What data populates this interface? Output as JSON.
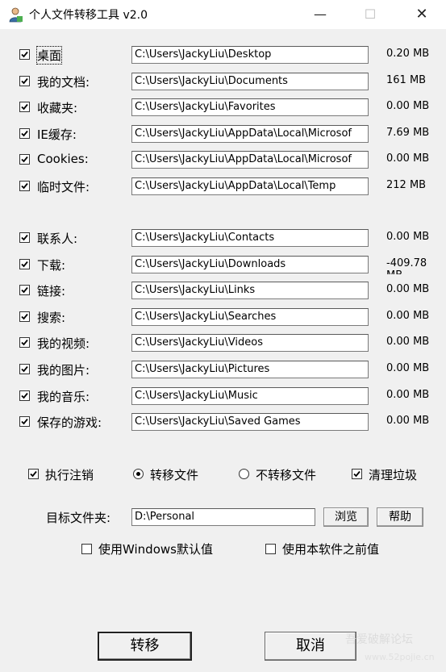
{
  "window": {
    "title": "个人文件转移工具 v2.0",
    "min": "—",
    "max": "☐",
    "close": "✕"
  },
  "folders_group1": [
    {
      "label": "桌面",
      "path": "C:\\Users\\JackyLiu\\Desktop",
      "size": "0.20 MB",
      "checked": true
    },
    {
      "label": "我的文档:",
      "path": "C:\\Users\\JackyLiu\\Documents",
      "size": "161  MB",
      "checked": true
    },
    {
      "label": "收藏夹:",
      "path": "C:\\Users\\JackyLiu\\Favorites",
      "size": "0.00 MB",
      "checked": true
    },
    {
      "label": "IE缓存:",
      "path": "C:\\Users\\JackyLiu\\AppData\\Local\\Microsof",
      "size": "7.69 MB",
      "checked": true
    },
    {
      "label": "Cookies:",
      "path": "C:\\Users\\JackyLiu\\AppData\\Local\\Microsof",
      "size": "0.00 MB",
      "checked": true
    },
    {
      "label": "临时文件:",
      "path": "C:\\Users\\JackyLiu\\AppData\\Local\\Temp",
      "size": "212  MB",
      "checked": true
    }
  ],
  "folders_group2": [
    {
      "label": "联系人:",
      "path": "C:\\Users\\JackyLiu\\Contacts",
      "size": "0.00 MB",
      "checked": true
    },
    {
      "label": "下载:",
      "path": "C:\\Users\\JackyLiu\\Downloads",
      "size": "-409.78",
      "size_extra": "MB",
      "checked": true
    },
    {
      "label": "链接:",
      "path": "C:\\Users\\JackyLiu\\Links",
      "size": "0.00 MB",
      "checked": true
    },
    {
      "label": "搜索:",
      "path": "C:\\Users\\JackyLiu\\Searches",
      "size": "0.00 MB",
      "checked": true
    },
    {
      "label": "我的视频:",
      "path": "C:\\Users\\JackyLiu\\Videos",
      "size": "0.00 MB",
      "checked": true
    },
    {
      "label": "我的图片:",
      "path": "C:\\Users\\JackyLiu\\Pictures",
      "size": "0.00 MB",
      "checked": true
    },
    {
      "label": "我的音乐:",
      "path": "C:\\Users\\JackyLiu\\Music",
      "size": "0.00 MB",
      "checked": true
    },
    {
      "label": "保存的游戏:",
      "path": "C:\\Users\\JackyLiu\\Saved Games",
      "size": "0.00 MB",
      "checked": true
    }
  ],
  "options": {
    "logoff": {
      "label": "执行注销",
      "checked": true
    },
    "move": {
      "label": "转移文件",
      "selected": true
    },
    "nomove": {
      "label": "不转移文件",
      "selected": false
    },
    "clean": {
      "label": "清理垃圾",
      "checked": true
    }
  },
  "target": {
    "label": "目标文件夹:",
    "value": "D:\\Personal",
    "browse": "浏览",
    "help": "帮助"
  },
  "defaults": {
    "windows_default": {
      "label": "使用Windows默认值",
      "checked": false
    },
    "previous": {
      "label": "使用本软件之前值",
      "checked": false
    }
  },
  "actions": {
    "move": "转移",
    "cancel": "取消"
  },
  "watermark": {
    "text": "吾爱破解论坛",
    "url": "www.52pojie.cn"
  }
}
